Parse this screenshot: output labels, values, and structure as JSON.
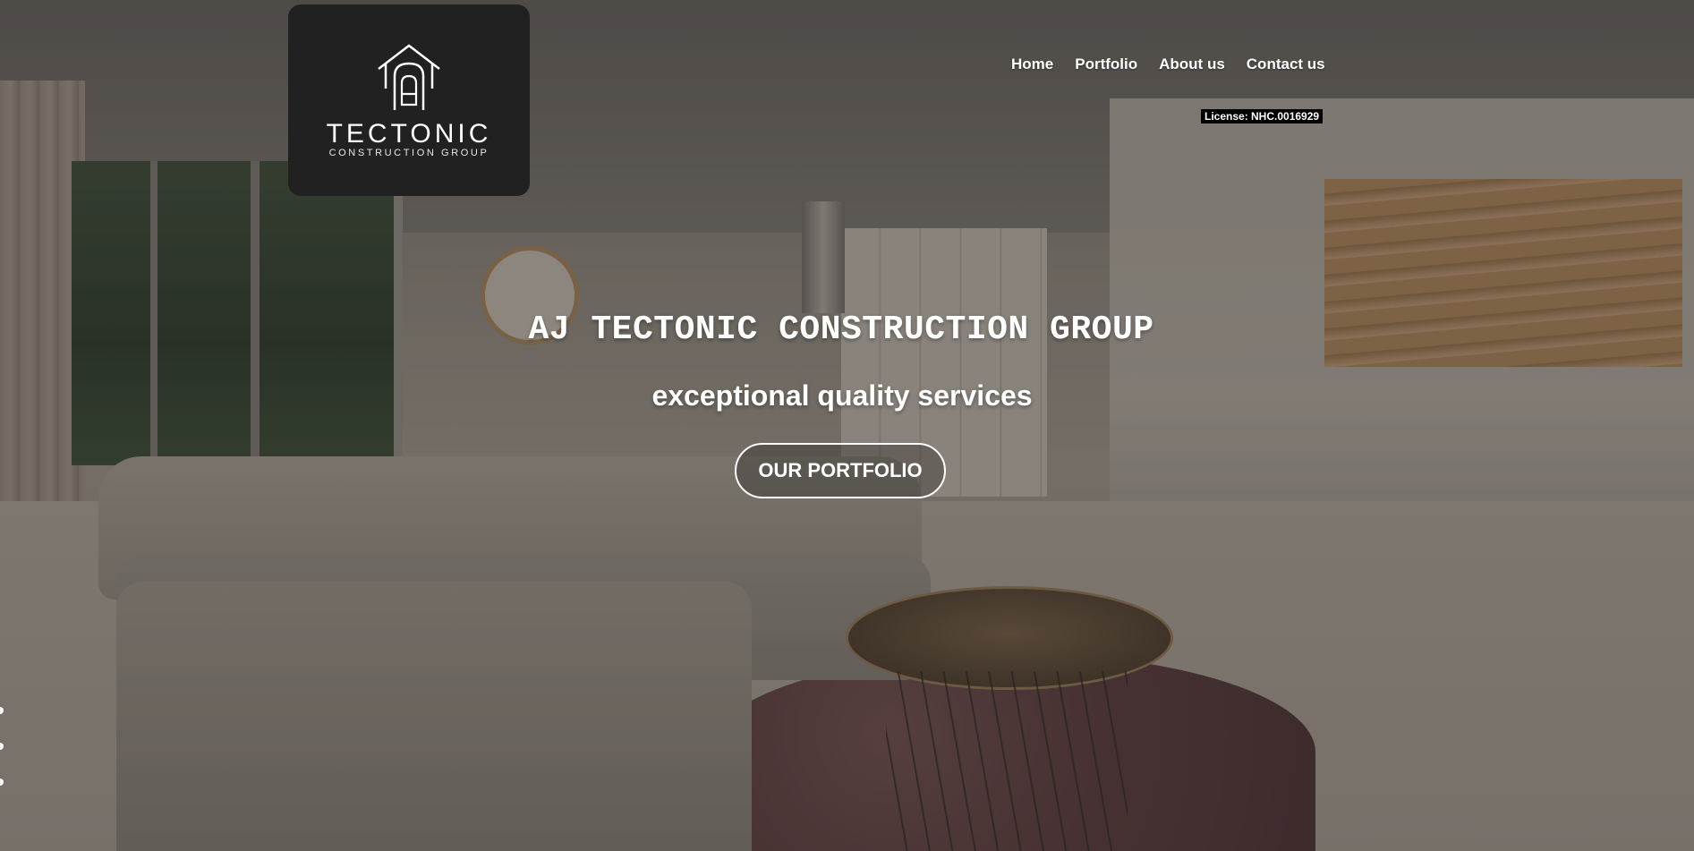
{
  "brand": {
    "logo_name": "TECTONIC",
    "logo_sub": "CONSTRUCTION GROUP"
  },
  "nav": {
    "items": [
      {
        "label": "Home"
      },
      {
        "label": "Portfolio"
      },
      {
        "label": "About us"
      },
      {
        "label": "Contact us"
      }
    ]
  },
  "license": "License: NHC.0016929",
  "hero": {
    "title": "AJ TECTONIC CONSTRUCTION GROUP",
    "subtitle": "exceptional quality services",
    "cta_label": "OUR PORTFOLIO"
  },
  "colors": {
    "logo_bg": "#212121",
    "text": "#ffffff",
    "license_bg": "#000000"
  }
}
